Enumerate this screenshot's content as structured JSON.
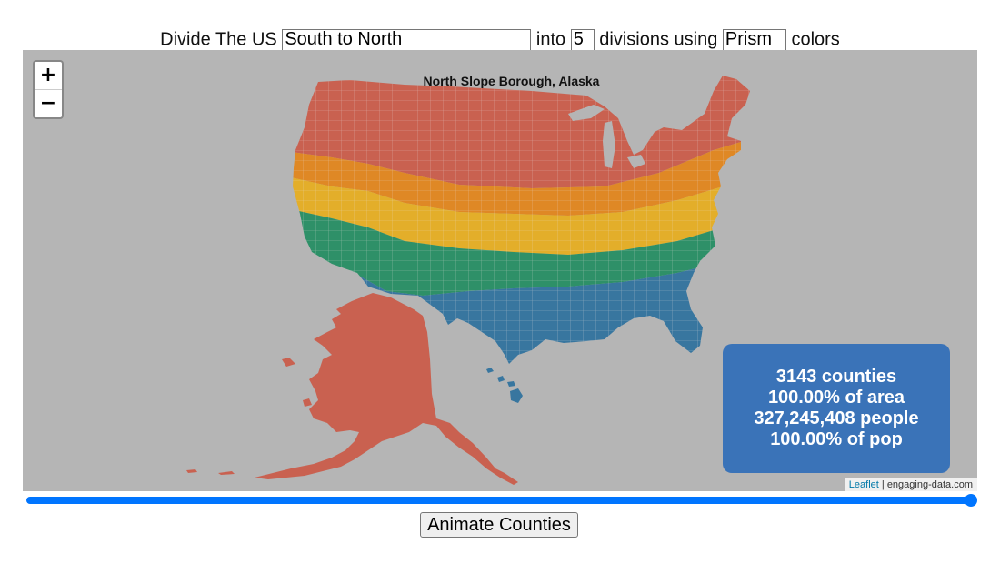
{
  "controls": {
    "prefix": "Divide The US",
    "direction_value": "South to North",
    "into_label": "into",
    "divisions_value": "5",
    "divisions_label": "divisions using",
    "color_scheme_value": "Prism",
    "colors_label": "colors"
  },
  "map": {
    "zoom_in_label": "+",
    "zoom_out_label": "−",
    "hover_label": "North Slope Borough, Alaska",
    "background_color": "#b5b5b5",
    "divisions": [
      {
        "index": 1,
        "position": "southernmost",
        "color": "#38769f"
      },
      {
        "index": 2,
        "position": "south-central",
        "color": "#2e9068"
      },
      {
        "index": 3,
        "position": "central",
        "color": "#e3ae2a"
      },
      {
        "index": 4,
        "position": "north-central",
        "color": "#df8825"
      },
      {
        "index": 5,
        "position": "northernmost",
        "color": "#c96150"
      }
    ],
    "regions": [
      {
        "name": "Alaska",
        "division": 5
      },
      {
        "name": "Hawaii",
        "division": 1
      }
    ],
    "attribution": {
      "leaflet_link": "Leaflet",
      "separator": " | ",
      "source": "engaging-data.com"
    }
  },
  "stats": {
    "counties": "3143 counties",
    "area": "100.00% of area",
    "people": "327,245,408 people",
    "pop": "100.00% of pop"
  },
  "slider": {
    "value_fraction": 1.0,
    "color": "#0075ff"
  },
  "animate_button": {
    "label": "Animate Counties"
  }
}
